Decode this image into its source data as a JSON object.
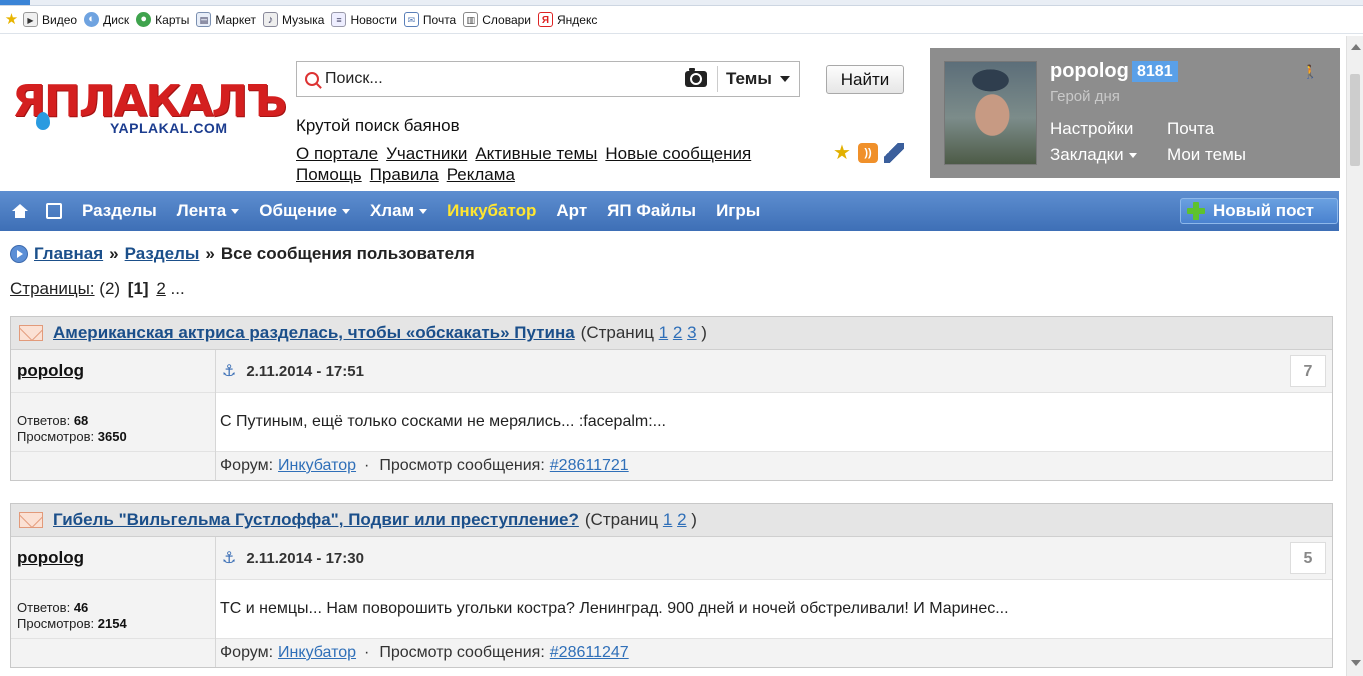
{
  "bookmarks": [
    {
      "label": "Видео",
      "icon": "video-icon"
    },
    {
      "label": "Диск",
      "icon": "disk-icon"
    },
    {
      "label": "Карты",
      "icon": "maps-icon"
    },
    {
      "label": "Маркет",
      "icon": "market-icon"
    },
    {
      "label": "Музыка",
      "icon": "music-icon"
    },
    {
      "label": "Новости",
      "icon": "news-icon"
    },
    {
      "label": "Почта",
      "icon": "mail-icon"
    },
    {
      "label": "Словари",
      "icon": "dictionary-icon"
    },
    {
      "label": "Яндекс",
      "icon": "yandex-icon"
    }
  ],
  "header": {
    "logo_main": "ЯПЛАКАЛЪ",
    "logo_sub": "YAPLAKAL.COM",
    "search_placeholder": "Поиск...",
    "topics_label": "Темы",
    "find_button": "Найти",
    "slogan": "Крутой поиск баянов",
    "links": [
      "О портале",
      "Участники",
      "Активные темы",
      "Новые сообщения",
      "Помощь",
      "Правила",
      "Реклама"
    ]
  },
  "user": {
    "name": "popolog",
    "rating": "8181",
    "title": "Герой дня",
    "links": {
      "settings": "Настройки",
      "mail": "Почта",
      "bookmarks": "Закладки",
      "my_topics": "Мои темы"
    }
  },
  "nav": {
    "items": [
      "Разделы",
      "Лента",
      "Общение",
      "Хлам",
      "Инкубатор",
      "Арт",
      "ЯП Файлы",
      "Игры"
    ],
    "new_post": "Новый пост"
  },
  "breadcrumb": {
    "home": "Главная",
    "sep": "»",
    "sections": "Разделы",
    "current": "Все сообщения пользователя"
  },
  "pagination": {
    "label": "Страницы:",
    "count": "(2)",
    "current": "[1]",
    "next": "2",
    "more": "..."
  },
  "labels": {
    "pages_prefix": "(Страниц",
    "pages_suffix": ")",
    "replies": "Ответов:",
    "views": "Просмотров:",
    "forum": "Форум:",
    "view_msg": "Просмотр сообщения:",
    "dot": "·"
  },
  "posts": [
    {
      "title": "Американская актриса разделась, чтобы «обскакать» Путина",
      "pages": [
        "1",
        "2",
        "3"
      ],
      "author": "popolog",
      "date": "2.11.2014 - 17:51",
      "num": "7",
      "replies": "68",
      "views": "3650",
      "text": "С Путиным, ещё только сосками не мерялись... :facepalm:...",
      "forum": "Инкубатор",
      "msg_id": "#28611721"
    },
    {
      "title": "Гибель \"Вильгельма Густлоффа\", Подвиг или преступление?",
      "pages": [
        "1",
        "2"
      ],
      "author": "popolog",
      "date": "2.11.2014 - 17:30",
      "num": "5",
      "replies": "46",
      "views": "2154",
      "text": "ТС и немцы... Нам поворошить угольки костра? Ленинград. 900 дней и ночей обстреливали! И Маринес...",
      "forum": "Инкубатор",
      "msg_id": "#28611247"
    }
  ]
}
